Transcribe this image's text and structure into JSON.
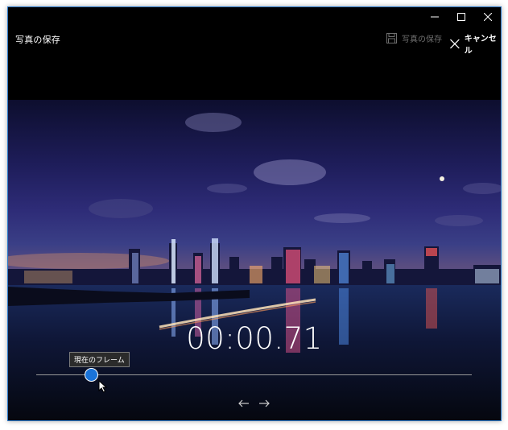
{
  "window": {
    "title": "写真の保存",
    "controls": {
      "minimize": "minimize-icon",
      "maximize": "maximize-icon",
      "close": "close-icon"
    }
  },
  "toolbar": {
    "save_label": "写真の保存",
    "save_icon": "floppy-disk-icon",
    "save_enabled": false,
    "cancel_label": "キャンセル",
    "cancel_icon": "close-icon"
  },
  "player": {
    "timecode": "00:00.71",
    "tooltip": "現在のフレーム",
    "scrub_position": 0.12,
    "accent_color": "#1a73d9",
    "prev_icon": "arrow-left-icon",
    "next_icon": "arrow-right-icon"
  }
}
